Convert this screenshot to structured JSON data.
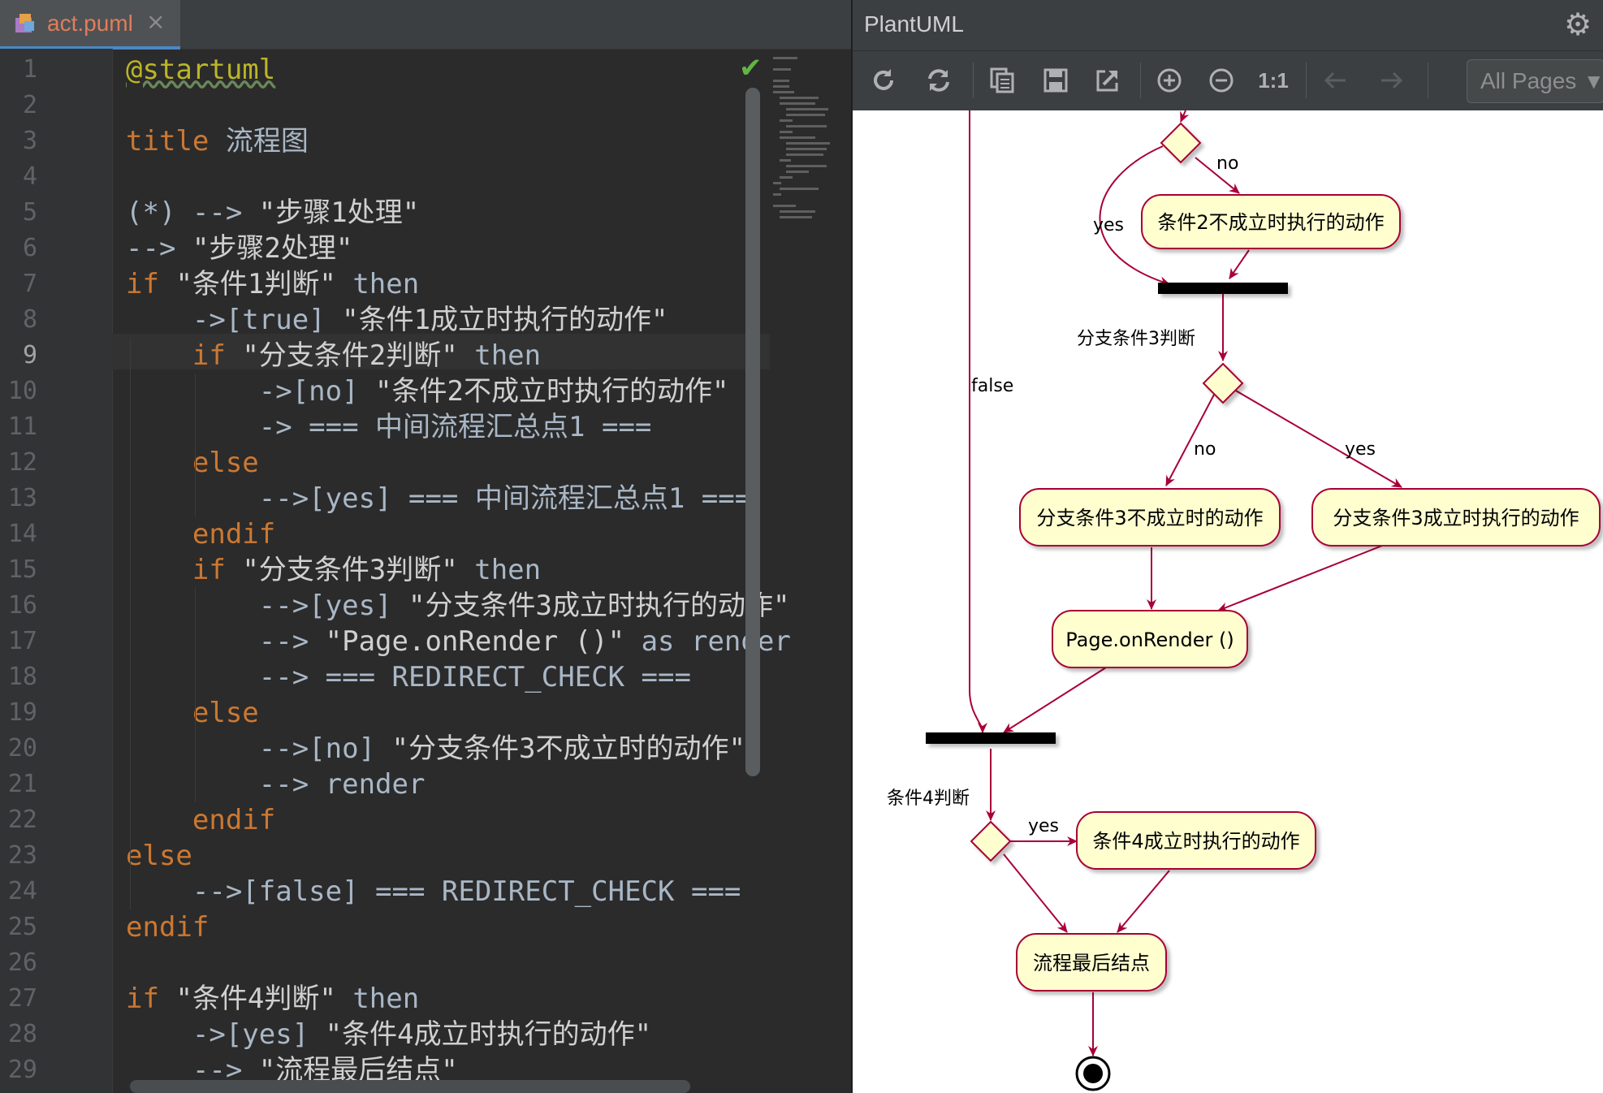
{
  "editor": {
    "tab": {
      "label": "act.puml",
      "close": "×"
    },
    "current_line": 9,
    "line_numbers": [
      "1",
      "2",
      "3",
      "4",
      "5",
      "6",
      "7",
      "8",
      "9",
      "10",
      "11",
      "12",
      "13",
      "14",
      "15",
      "16",
      "17",
      "18",
      "19",
      "20",
      "21",
      "22",
      "23",
      "24",
      "25",
      "26",
      "27",
      "28",
      "29"
    ],
    "lines": [
      [
        [
          "ann",
          "@startuml"
        ]
      ],
      [],
      [
        [
          "kw",
          "title"
        ],
        [
          "plain",
          " 流程图"
        ]
      ],
      [],
      [
        [
          "plain",
          "(*) --> "
        ],
        [
          "str",
          "\"步骤1处理\""
        ]
      ],
      [
        [
          "plain",
          "--> "
        ],
        [
          "str",
          "\"步骤2处理\""
        ]
      ],
      [
        [
          "kw",
          "if"
        ],
        [
          "plain",
          " "
        ],
        [
          "str",
          "\"条件1判断\""
        ],
        [
          "plain",
          " then"
        ]
      ],
      [
        [
          "plain",
          "    ->[true] "
        ],
        [
          "str",
          "\"条件1成立时执行的动作\""
        ]
      ],
      [
        [
          "plain",
          "    "
        ],
        [
          "kw",
          "if"
        ],
        [
          "plain",
          " "
        ],
        [
          "str",
          "\"分支条件2判断\""
        ],
        [
          "plain",
          " then"
        ]
      ],
      [
        [
          "plain",
          "        ->[no] "
        ],
        [
          "str",
          "\"条件2不成立时执行的动作\""
        ]
      ],
      [
        [
          "plain",
          "        -> === 中间流程汇总点1 ==="
        ]
      ],
      [
        [
          "plain",
          "    "
        ],
        [
          "kw",
          "else"
        ]
      ],
      [
        [
          "plain",
          "        -->[yes] === 中间流程汇总点1 ==="
        ]
      ],
      [
        [
          "plain",
          "    "
        ],
        [
          "kw",
          "endif"
        ]
      ],
      [
        [
          "plain",
          "    "
        ],
        [
          "kw",
          "if"
        ],
        [
          "plain",
          " "
        ],
        [
          "str",
          "\"分支条件3判断\""
        ],
        [
          "plain",
          " then"
        ]
      ],
      [
        [
          "plain",
          "        -->[yes] "
        ],
        [
          "str",
          "\"分支条件3成立时执行的动作\""
        ]
      ],
      [
        [
          "plain",
          "        --> "
        ],
        [
          "str",
          "\"Page.onRender ()\""
        ],
        [
          "plain",
          " as render"
        ]
      ],
      [
        [
          "plain",
          "        --> === REDIRECT_CHECK ==="
        ]
      ],
      [
        [
          "plain",
          "    "
        ],
        [
          "kw",
          "else"
        ]
      ],
      [
        [
          "plain",
          "        -->[no] "
        ],
        [
          "str",
          "\"分支条件3不成立时的动作\""
        ]
      ],
      [
        [
          "plain",
          "        --> render"
        ]
      ],
      [
        [
          "plain",
          "    "
        ],
        [
          "kw",
          "endif"
        ]
      ],
      [
        [
          "kw",
          "else"
        ]
      ],
      [
        [
          "plain",
          "    -->[false] === REDIRECT_CHECK ==="
        ]
      ],
      [
        [
          "kw",
          "endif"
        ]
      ],
      [],
      [
        [
          "kw",
          "if"
        ],
        [
          "plain",
          " "
        ],
        [
          "str",
          "\"条件4判断\""
        ],
        [
          "plain",
          " then"
        ]
      ],
      [
        [
          "plain",
          "    ->[yes] "
        ],
        [
          "str",
          "\"条件4成立时执行的动作\""
        ]
      ],
      [
        [
          "plain",
          "    --> "
        ],
        [
          "str",
          "\"流程最后结点\""
        ]
      ]
    ]
  },
  "plantuml": {
    "title": "PlantUML",
    "toolbar": {
      "icons": [
        "refresh-icon",
        "sync-icon",
        "copy-icon",
        "save-icon",
        "export-icon",
        "zoom-in-icon",
        "zoom-out-icon",
        "actual-size-icon",
        "back-icon",
        "forward-icon"
      ],
      "actual_size_label": "1:1",
      "pages_selected": "All Pages"
    },
    "diagram": {
      "nodes": {
        "cond2_no_action": "条件2不成立时执行的动作",
        "branch3_no_action": "分支条件3不成立时的动作",
        "branch3_yes_action": "分支条件3成立时执行的动作",
        "render": "Page.onRender ()",
        "cond4_yes_action": "条件4成立时执行的动作",
        "final_node": "流程最后结点"
      },
      "labels": {
        "no_top": "no",
        "yes_top": "yes",
        "branch3_title": "分支条件3判断",
        "false_edge": "false",
        "branch3_no": "no",
        "branch3_yes": "yes",
        "cond4_title": "条件4判断",
        "cond4_yes": "yes"
      },
      "colors": {
        "activity_fill": "#fefecf",
        "border": "#a80036",
        "bar": "#000000"
      }
    }
  }
}
